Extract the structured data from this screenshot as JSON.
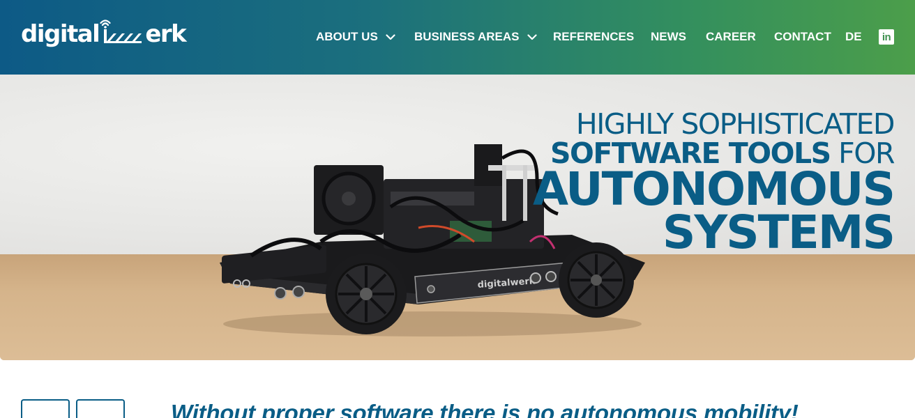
{
  "brand": {
    "logo_prefix": "digital",
    "logo_suffix": "erk",
    "logo_text": "digitalwerk"
  },
  "nav": {
    "items": [
      {
        "label": "ABOUT US",
        "has_dropdown": true
      },
      {
        "label": "BUSINESS AREAS",
        "has_dropdown": true
      },
      {
        "label": "REFERENCES",
        "has_dropdown": false
      },
      {
        "label": "NEWS",
        "has_dropdown": false
      },
      {
        "label": "CAREER",
        "has_dropdown": false
      },
      {
        "label": "CONTACT",
        "has_dropdown": false
      }
    ],
    "language": "DE",
    "social_icon": "linkedin-icon"
  },
  "hero": {
    "line1": "HIGHLY SOPHISTICATED",
    "line2_bold": "SOFTWARE TOOLS",
    "line2_regular": "FOR",
    "line3": "AUTONOMOUS",
    "line4": "SYSTEMS",
    "car_badge": "digitalwerk"
  },
  "intro": {
    "title": "Without proper software there is no autonomous mobility!"
  },
  "colors": {
    "primary": "#0a5d86",
    "header_gradient_start": "#0d5a86",
    "header_gradient_end": "#4c9e4a",
    "white": "#ffffff"
  }
}
